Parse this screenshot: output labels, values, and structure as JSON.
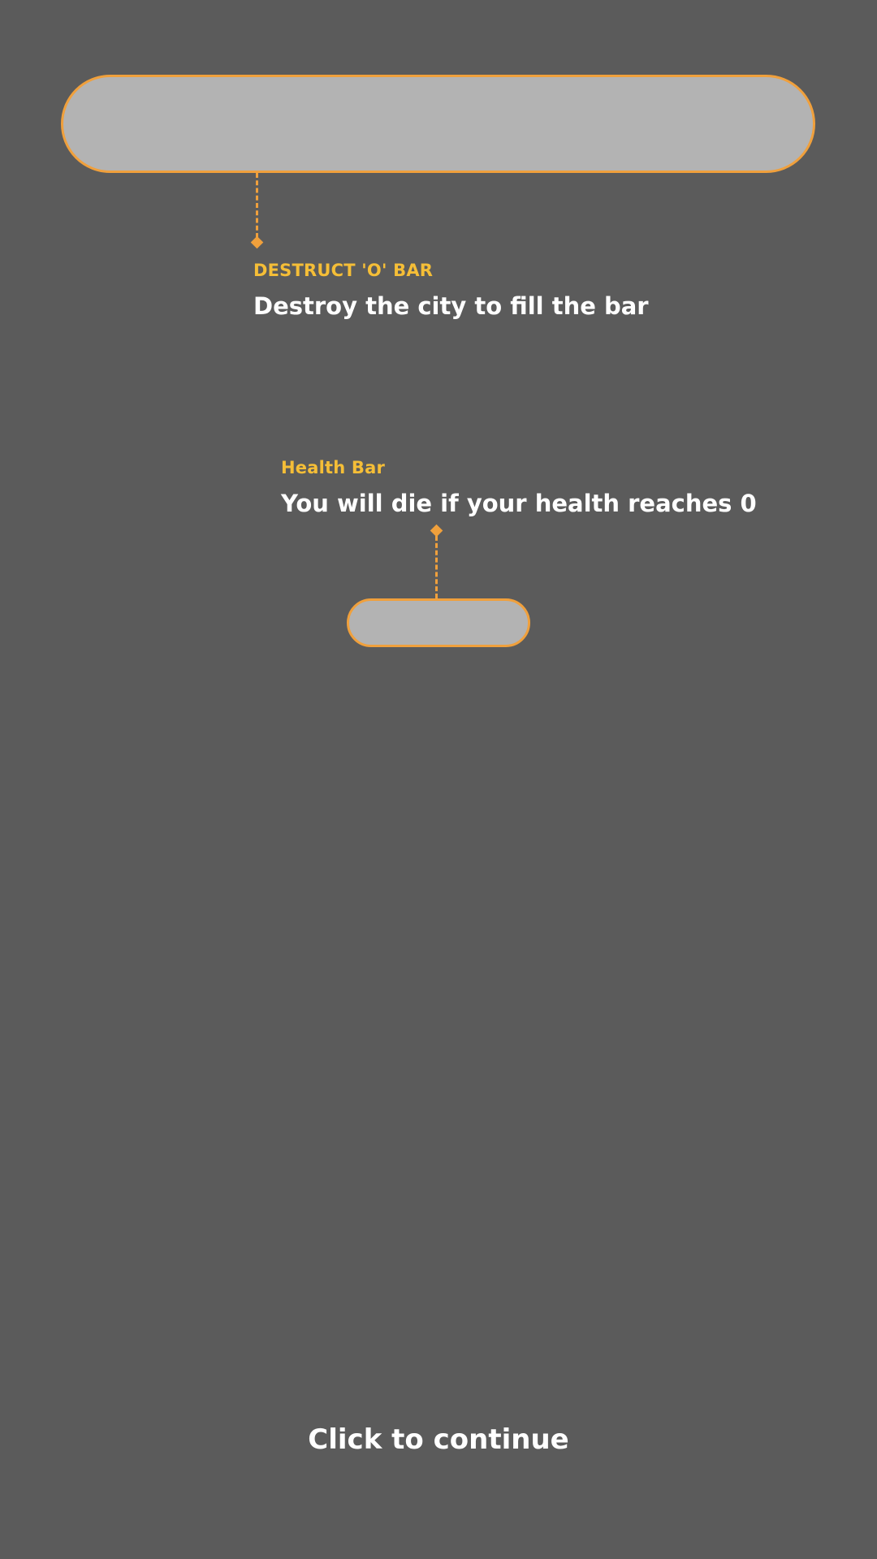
{
  "tutorial": {
    "destruct_bar": {
      "title": "DESTRUCT 'O' BAR",
      "description": "Destroy the city to fill the bar"
    },
    "health_bar": {
      "title": "Health Bar",
      "description": "You will die if your health reaches 0"
    },
    "continue_label": "Click to continue"
  },
  "colors": {
    "background": "#5b5b5b",
    "bar_fill": "#b3b3b3",
    "highlight_outline": "#f0a03c",
    "caption_title": "#f5be37",
    "caption_text": "#ffffff"
  }
}
